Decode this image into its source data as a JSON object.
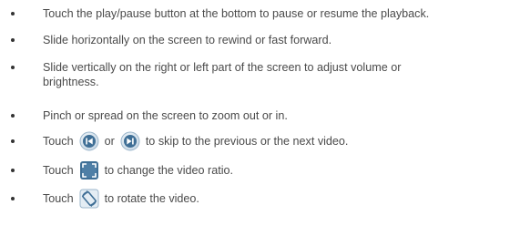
{
  "items": [
    {
      "text": "Touch the play/pause button at the bottom to pause or resume the playback."
    },
    {
      "text": "Slide horizontally on the screen to rewind or fast forward."
    },
    {
      "text": "Slide vertically on the right or left part of the screen to adjust volume or brightness."
    },
    {
      "text": "Pinch or spread on the screen to zoom out or in."
    },
    {
      "before": "Touch",
      "middle": "or",
      "after": "to skip to the previous or the next video.",
      "icons": [
        "skip-previous-icon",
        "skip-next-icon"
      ]
    },
    {
      "before": "Touch",
      "after": "to change the video ratio.",
      "icons": [
        "video-ratio-icon"
      ]
    },
    {
      "before": "Touch",
      "after": "to rotate the video.",
      "icons": [
        "rotate-icon"
      ]
    }
  ],
  "colors": {
    "text": "#4a4a4a",
    "icon_dark": "#3f6f96",
    "icon_light": "#e8f0f6"
  }
}
